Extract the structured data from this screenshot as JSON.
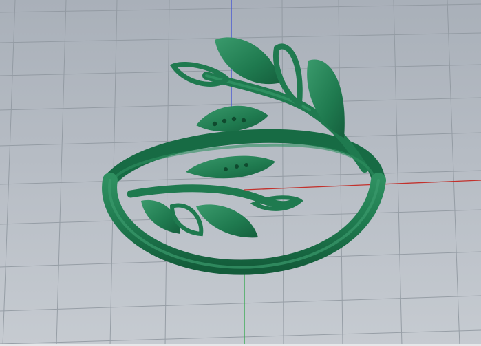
{
  "viewport": {
    "view": "Perspective",
    "background_top": "#a9b0b9",
    "background_bottom": "#c6cbd1",
    "grid_color": "#8f979f",
    "model_color": "#1f7a4f",
    "model_shade": "#135c3a",
    "model_highlight": "#3a9a6c",
    "axes": {
      "x_color": "#c2312c",
      "y_color": "#2fa84a",
      "z_color": "#3d4fd6"
    }
  }
}
